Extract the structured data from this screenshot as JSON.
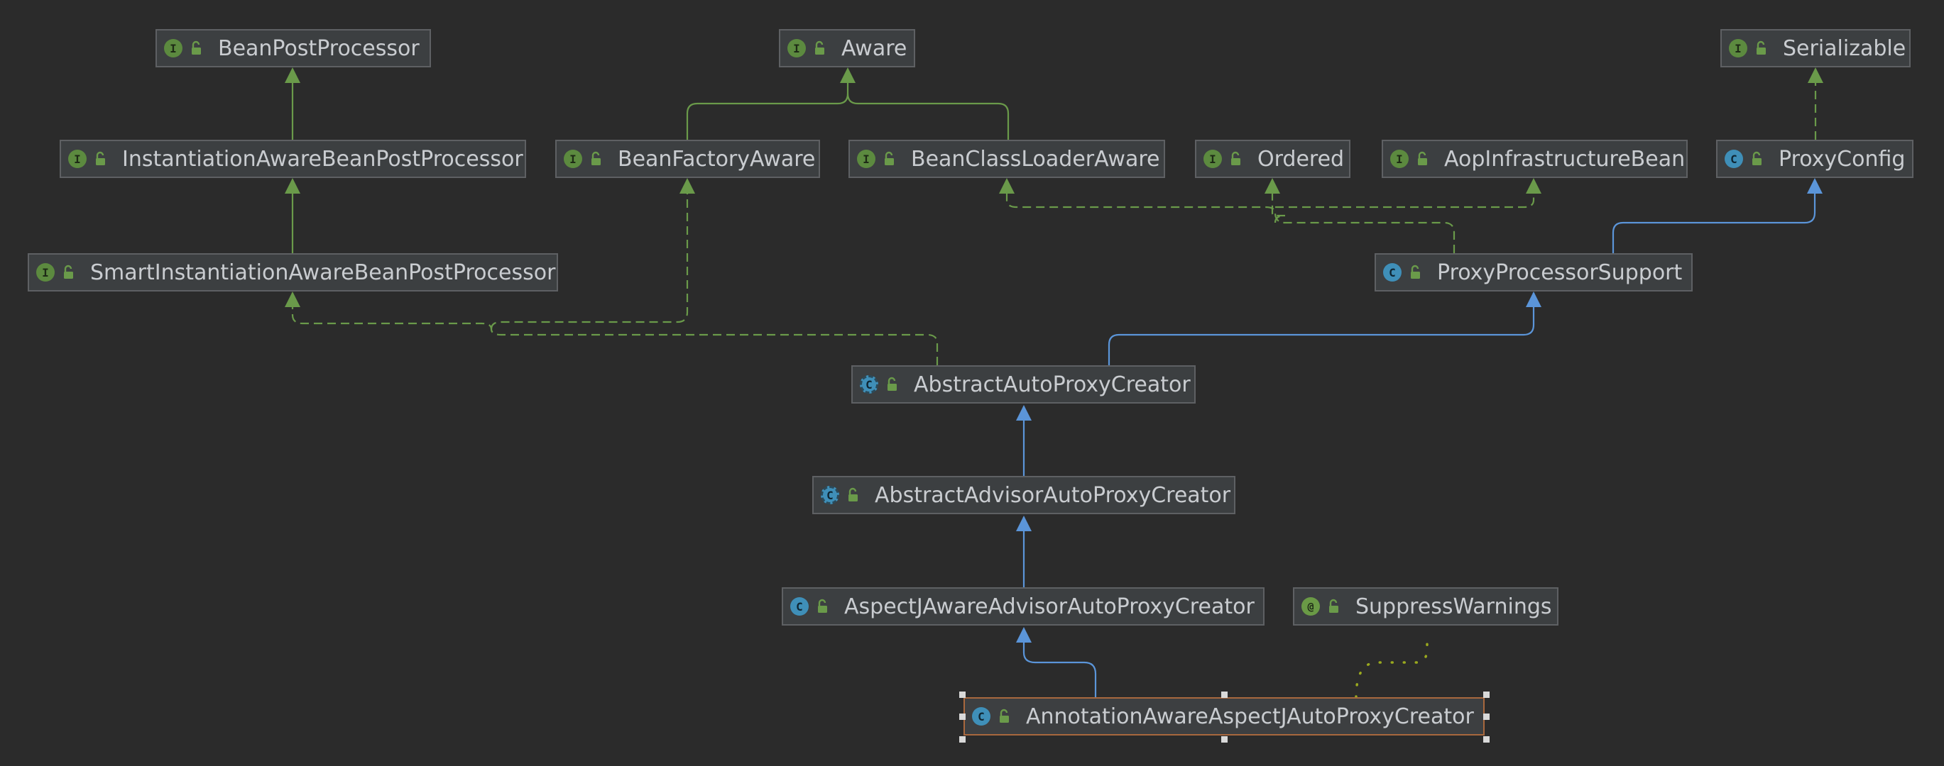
{
  "diagram": {
    "background": "#2b2b2b",
    "colors": {
      "implements": "#6a9a4a",
      "extends": "#5b95d9",
      "annotated": "#9aa91e",
      "node_bg": "#3c3f41",
      "node_border": "#5e6063",
      "selected_border": "#a8683e",
      "text": "#c9ccd0"
    },
    "nodes": [
      {
        "id": "bpp",
        "label": "BeanPostProcessor",
        "kind": "interface",
        "icon": "interface-icon"
      },
      {
        "id": "aware",
        "label": "Aware",
        "kind": "interface",
        "icon": "interface-icon"
      },
      {
        "id": "serializable",
        "label": "Serializable",
        "kind": "interface",
        "icon": "interface-icon"
      },
      {
        "id": "iabpp",
        "label": "InstantiationAwareBeanPostProcessor",
        "kind": "interface",
        "icon": "interface-icon"
      },
      {
        "id": "bfa",
        "label": "BeanFactoryAware",
        "kind": "interface",
        "icon": "interface-icon"
      },
      {
        "id": "bcla",
        "label": "BeanClassLoaderAware",
        "kind": "interface",
        "icon": "interface-icon"
      },
      {
        "id": "ordered",
        "label": "Ordered",
        "kind": "interface",
        "icon": "interface-icon"
      },
      {
        "id": "aib",
        "label": "AopInfrastructureBean",
        "kind": "interface",
        "icon": "interface-icon"
      },
      {
        "id": "proxyconfig",
        "label": "ProxyConfig",
        "kind": "class",
        "icon": "class-icon"
      },
      {
        "id": "siabpp",
        "label": "SmartInstantiationAwareBeanPostProcessor",
        "kind": "interface",
        "icon": "interface-icon"
      },
      {
        "id": "pps",
        "label": "ProxyProcessorSupport",
        "kind": "class",
        "icon": "class-icon"
      },
      {
        "id": "aapc",
        "label": "AbstractAutoProxyCreator",
        "kind": "abstract",
        "icon": "abstract-class-icon"
      },
      {
        "id": "aaapc",
        "label": "AbstractAdvisorAutoProxyCreator",
        "kind": "abstract",
        "icon": "abstract-class-icon"
      },
      {
        "id": "ajaapc",
        "label": "AspectJAwareAdvisorAutoProxyCreator",
        "kind": "class",
        "icon": "class-icon"
      },
      {
        "id": "sw",
        "label": "SuppressWarnings",
        "kind": "annotation",
        "icon": "annotation-icon"
      },
      {
        "id": "aaajapc",
        "label": "AnnotationAwareAspectJAutoProxyCreator",
        "kind": "class",
        "icon": "class-icon",
        "selected": true
      }
    ],
    "edges": [
      {
        "from": "iabpp",
        "to": "bpp",
        "type": "extends-interface"
      },
      {
        "from": "siabpp",
        "to": "iabpp",
        "type": "extends-interface"
      },
      {
        "from": "bfa",
        "to": "aware",
        "type": "extends-interface"
      },
      {
        "from": "bcla",
        "to": "aware",
        "type": "extends-interface"
      },
      {
        "from": "proxyconfig",
        "to": "serializable",
        "type": "implements"
      },
      {
        "from": "pps",
        "to": "proxyconfig",
        "type": "extends"
      },
      {
        "from": "pps",
        "to": "bcla",
        "type": "implements"
      },
      {
        "from": "pps",
        "to": "ordered",
        "type": "implements"
      },
      {
        "from": "pps",
        "to": "aib",
        "type": "implements"
      },
      {
        "from": "aapc",
        "to": "pps",
        "type": "extends"
      },
      {
        "from": "aapc",
        "to": "siabpp",
        "type": "implements"
      },
      {
        "from": "aapc",
        "to": "bfa",
        "type": "implements"
      },
      {
        "from": "aaapc",
        "to": "aapc",
        "type": "extends"
      },
      {
        "from": "ajaapc",
        "to": "aaapc",
        "type": "extends"
      },
      {
        "from": "aaajapc",
        "to": "ajaapc",
        "type": "extends"
      },
      {
        "from": "aaajapc",
        "to": "sw",
        "type": "annotated"
      }
    ]
  }
}
